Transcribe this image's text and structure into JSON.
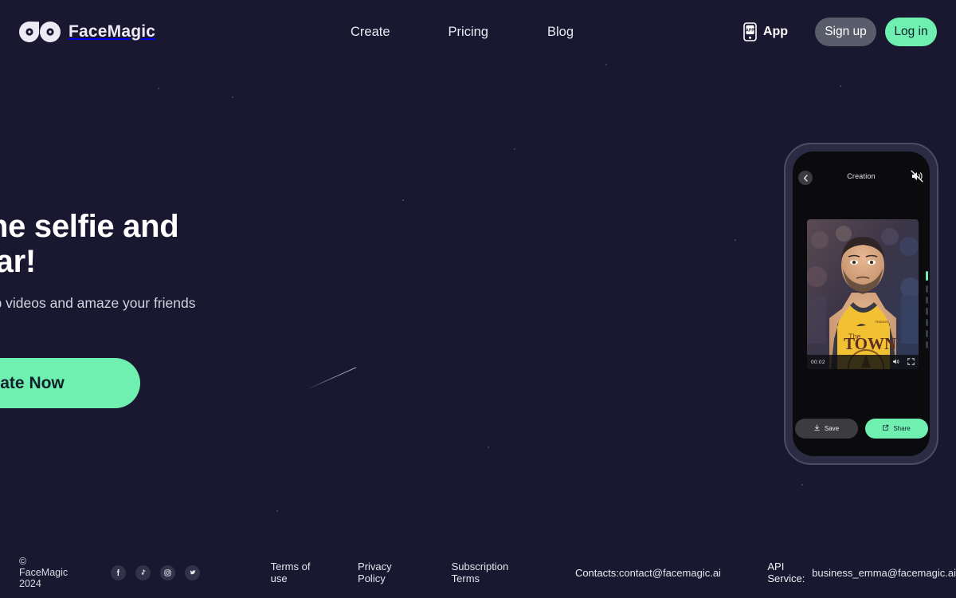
{
  "brand": {
    "name": "FaceMagic",
    "logo_icon": "two-eyes-logo-icon"
  },
  "nav": {
    "items": [
      {
        "label": "Create"
      },
      {
        "label": "Pricing"
      },
      {
        "label": "Blog"
      }
    ]
  },
  "header_actions": {
    "app_label": "App",
    "app_icon": "mobile-phone-icon",
    "app_icon_text": "APP",
    "signup_label": "Sign up",
    "login_label": "Log in",
    "signup_bg": "#595c6b",
    "login_bg": "#6ff0b0"
  },
  "hero": {
    "title_line1": "Just one selfie and",
    "title_line2": "be a star!",
    "subtitle": "create face swap videos and amaze your friends",
    "cta_label": "Create Now",
    "cta_bg": "#6ff0b0"
  },
  "phone": {
    "back_icon": "chevron-left-icon",
    "title": "Creation",
    "mute_icon": "speaker-muted-icon",
    "video": {
      "timestamp": "00:02",
      "volume_icon": "speaker-icon",
      "fullscreen_icon": "fullscreen-icon",
      "alt": "basketball player in yellow THE TOWN jersey"
    },
    "save_label": "Save",
    "save_icon": "download-icon",
    "share_label": "Share",
    "share_icon": "share-external-icon",
    "share_bg": "#6ff0b0"
  },
  "footer": {
    "copyright": "© FaceMagic 2024",
    "socials": [
      {
        "name": "facebook-icon"
      },
      {
        "name": "tiktok-icon"
      },
      {
        "name": "instagram-icon"
      },
      {
        "name": "twitter-icon"
      }
    ],
    "links": [
      {
        "label": "Terms of use"
      },
      {
        "label": "Privacy Policy"
      },
      {
        "label": "Subscription Terms"
      }
    ],
    "contacts_label": "Contacts:",
    "contacts_email": "contact@facemagic.ai",
    "api_label": "API Service:",
    "api_email": "business_emma@facemagic.ai",
    "link_color": "#4f7cf7"
  },
  "theme": {
    "background": "#191830",
    "accent": "#6ff0b0"
  }
}
